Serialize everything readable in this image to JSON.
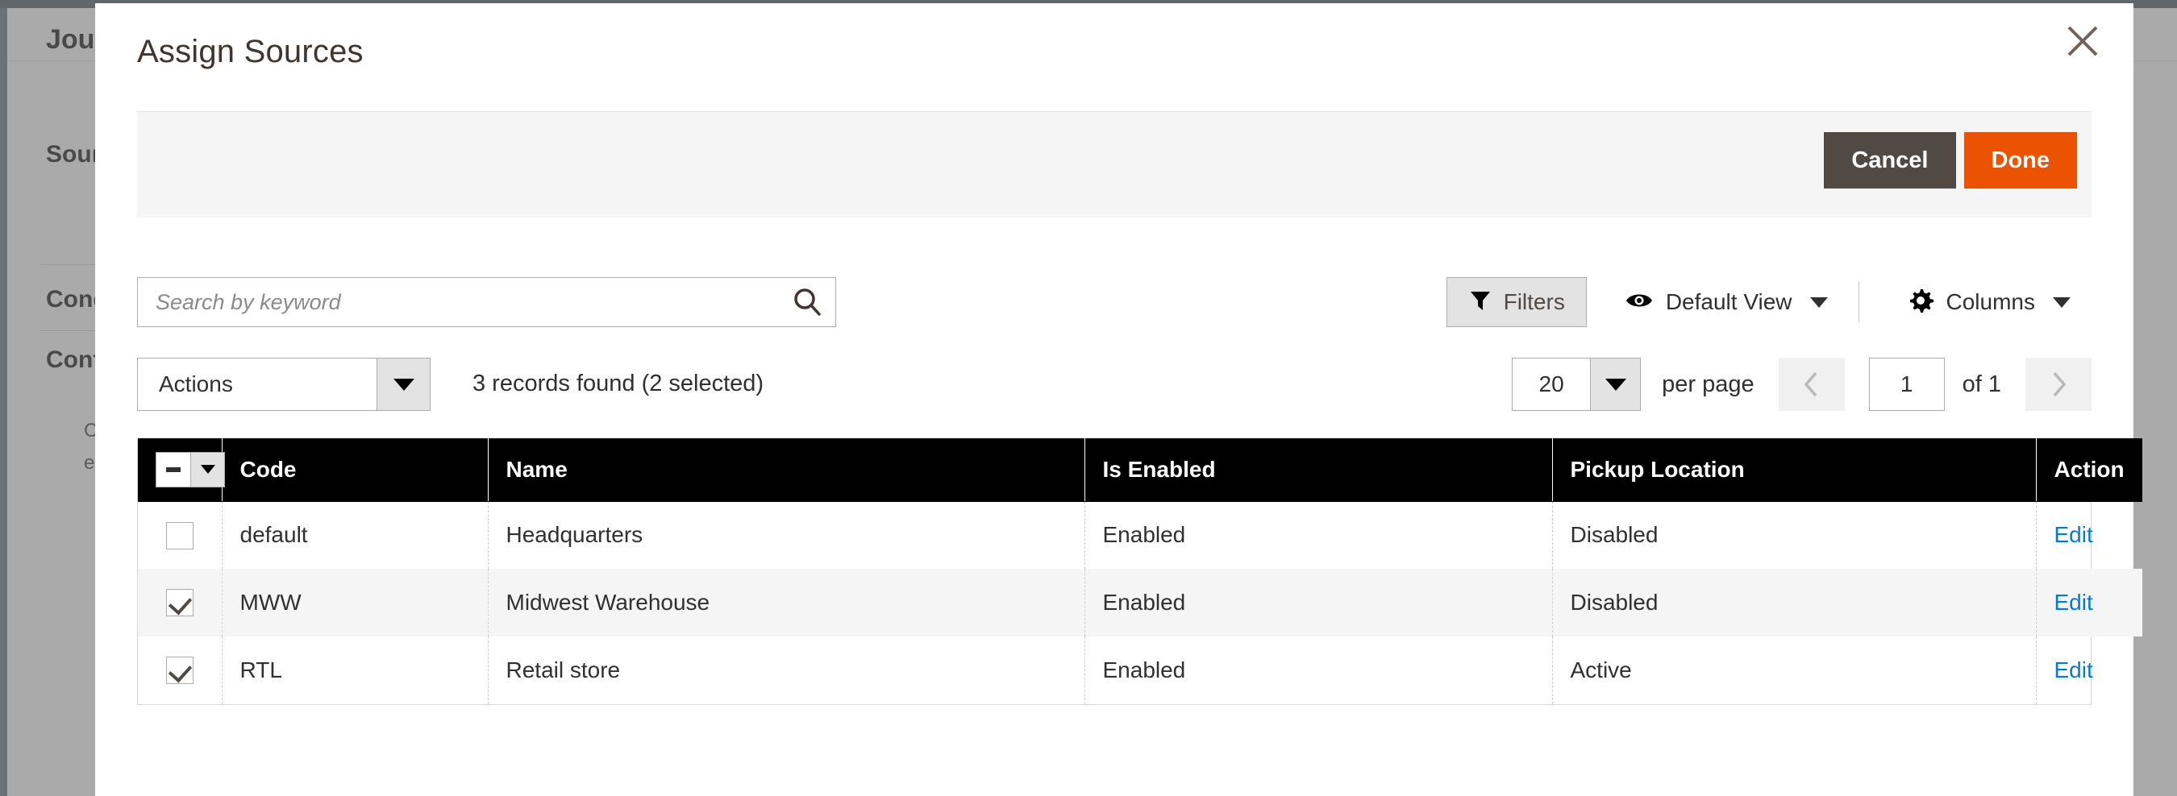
{
  "background_page": {
    "heading": "Journal",
    "section_sources": "Sources",
    "section_conditions": "Conditions",
    "section_configuration": "Configurations",
    "paragraph": "Configure the sources\neach of the items"
  },
  "modal": {
    "title": "Assign Sources",
    "close_icon": "close-icon",
    "actions": {
      "cancel_label": "Cancel",
      "done_label": "Done"
    },
    "search": {
      "placeholder": "Search by keyword",
      "value": "",
      "icon": "search-icon"
    },
    "view_controls": {
      "filters_label": "Filters",
      "filters_icon": "filter-icon",
      "view_icon": "eye-icon",
      "view_label": "Default View",
      "columns_icon": "gear-icon",
      "columns_label": "Columns",
      "caret_icon": "chevron-down-icon"
    },
    "toolbar": {
      "actions_label": "Actions",
      "records_text": "3 records found (2 selected)"
    },
    "pagination": {
      "per_page_value": "20",
      "per_page_label": "per page",
      "prev_icon": "chevron-left-icon",
      "next_icon": "chevron-right-icon",
      "page_value": "1",
      "of_label": "of 1"
    },
    "grid": {
      "mass_select_state": "indeterminate",
      "columns": [
        {
          "key": "checkbox",
          "label": ""
        },
        {
          "key": "code",
          "label": "Code"
        },
        {
          "key": "name",
          "label": "Name"
        },
        {
          "key": "is_enabled",
          "label": "Is Enabled"
        },
        {
          "key": "pickup_location",
          "label": "Pickup Location"
        },
        {
          "key": "action",
          "label": "Action"
        }
      ],
      "rows": [
        {
          "selected": false,
          "code": "default",
          "name": "Headquarters",
          "is_enabled": "Enabled",
          "pickup_location": "Disabled",
          "action": "Edit"
        },
        {
          "selected": true,
          "code": "MWW",
          "name": "Midwest Warehouse",
          "is_enabled": "Enabled",
          "pickup_location": "Disabled",
          "action": "Edit"
        },
        {
          "selected": true,
          "code": "RTL",
          "name": "Retail store",
          "is_enabled": "Enabled",
          "pickup_location": "Active",
          "action": "Edit"
        }
      ]
    }
  },
  "colors": {
    "accent_orange": "#eb5202",
    "cancel_gray": "#514943",
    "link_blue": "#007bdb",
    "header_black": "#000000",
    "topbar": "#3d4e57"
  }
}
